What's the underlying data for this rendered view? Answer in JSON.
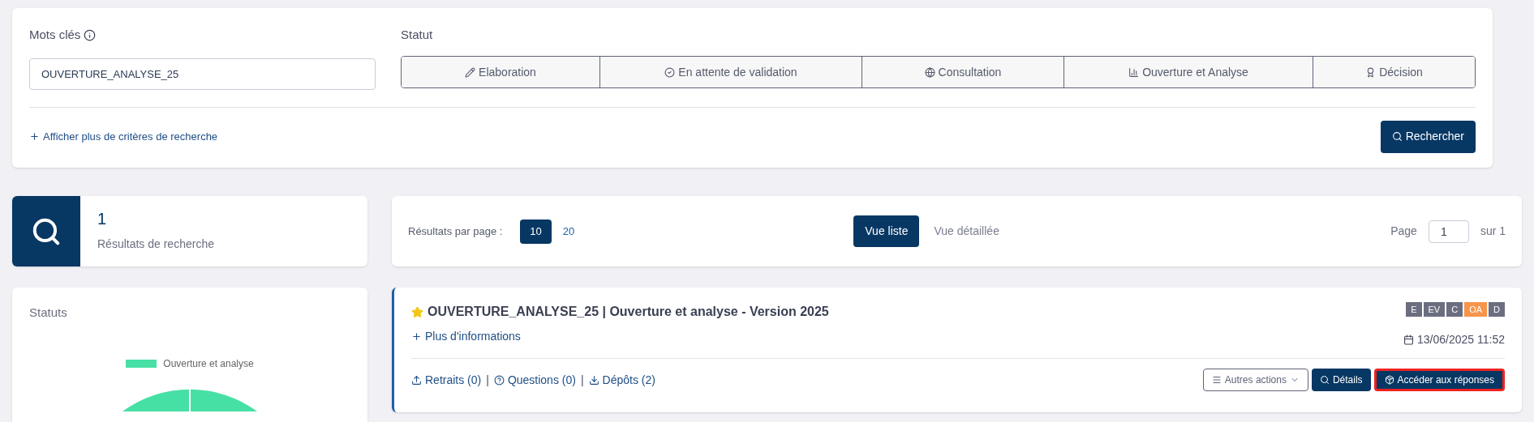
{
  "search": {
    "keywords_label": "Mots clés",
    "keywords_value": "OUVERTURE_ANALYSE_25",
    "status_label": "Statut",
    "statuses": [
      {
        "label": "Elaboration",
        "selected": false
      },
      {
        "label": "En attente de validation",
        "selected": false
      },
      {
        "label": "Consultation",
        "selected": false
      },
      {
        "label": "Ouverture et Analyse",
        "selected": false
      },
      {
        "label": "Décision",
        "selected": false
      }
    ],
    "more_criteria_link": "Afficher plus de critères de recherche",
    "search_button": "Rechercher"
  },
  "summary": {
    "count": "1",
    "label": "Résultats de recherche"
  },
  "toolbar": {
    "per_page_label": "Résultats par page :",
    "per_page_options": [
      {
        "label": "10",
        "selected": true
      },
      {
        "label": "20",
        "selected": false
      }
    ],
    "views": [
      {
        "label": "Vue liste",
        "selected": true
      },
      {
        "label": "Vue détaillée",
        "selected": false
      }
    ],
    "page_label": "Page",
    "page_value": "1",
    "page_total": "sur 1"
  },
  "statuts_panel": {
    "title": "Statuts",
    "legend": [
      {
        "label": "Ouverture et analyse",
        "color": "#47e0a4"
      }
    ]
  },
  "result": {
    "favorite": true,
    "title": "OUVERTURE_ANALYSE_25 | Ouverture et analyse - Version 2025",
    "more_info_link": "Plus d'informations",
    "phases": [
      {
        "label": "E",
        "active": false
      },
      {
        "label": "EV",
        "active": false
      },
      {
        "label": "C",
        "active": false
      },
      {
        "label": "OA",
        "active": true
      },
      {
        "label": "D",
        "active": false
      }
    ],
    "date": "13/06/2025 11:52",
    "links": [
      {
        "label": "Retraits (0)"
      },
      {
        "label": "Questions (0)"
      },
      {
        "label": "Dépôts (2)"
      }
    ],
    "separators": [
      "|",
      "|"
    ],
    "actions": [
      {
        "label": "Autres actions",
        "kind": "menu",
        "highlighted": false
      },
      {
        "label": "Détails",
        "kind": "search",
        "highlighted": false
      },
      {
        "label": "Accéder aux réponses",
        "kind": "box",
        "highlighted": true
      }
    ]
  }
}
